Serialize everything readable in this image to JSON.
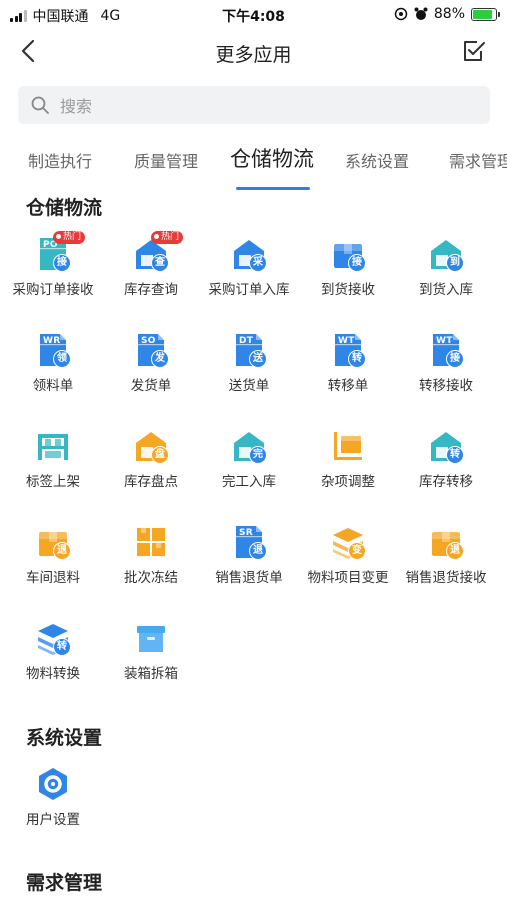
{
  "status_bar": {
    "carrier": "中国联通",
    "network": "4G",
    "time": "下午4:08",
    "battery": "88%"
  },
  "nav": {
    "title": "更多应用"
  },
  "search": {
    "placeholder": "搜索"
  },
  "tabs": [
    {
      "label": "制造执行"
    },
    {
      "label": "质量管理"
    },
    {
      "label": "仓储物流",
      "active": true
    },
    {
      "label": "系统设置"
    },
    {
      "label": "需求管理"
    }
  ],
  "sections": {
    "warehouse": {
      "title": "仓储物流",
      "apps": [
        {
          "label": "采购订单接收",
          "icon": "purchase-order-receive-icon",
          "code": "PO",
          "badge": "接",
          "hot": "热门"
        },
        {
          "label": "库存查询",
          "icon": "inventory-query-icon",
          "badge": "查",
          "hot": "热门"
        },
        {
          "label": "采购订单入库",
          "icon": "purchase-order-inbound-icon",
          "badge": "采"
        },
        {
          "label": "到货接收",
          "icon": "arrival-receive-icon",
          "badge": "接"
        },
        {
          "label": "到货入库",
          "icon": "arrival-inbound-icon",
          "badge": "到"
        },
        {
          "label": "领料单",
          "icon": "material-requisition-icon",
          "code": "WR",
          "badge": "领"
        },
        {
          "label": "发货单",
          "icon": "shipping-order-icon",
          "code": "SO",
          "badge": "发"
        },
        {
          "label": "送货单",
          "icon": "delivery-note-icon",
          "code": "DT",
          "badge": "送"
        },
        {
          "label": "转移单",
          "icon": "transfer-order-icon",
          "code": "WT",
          "badge": "转"
        },
        {
          "label": "转移接收",
          "icon": "transfer-receive-icon",
          "code": "WT",
          "badge": "接"
        },
        {
          "label": "标签上架",
          "icon": "label-shelving-icon"
        },
        {
          "label": "库存盘点",
          "icon": "stocktaking-icon",
          "badge": "盘"
        },
        {
          "label": "完工入库",
          "icon": "completion-inbound-icon",
          "badge": "完"
        },
        {
          "label": "杂项调整",
          "icon": "misc-adjustment-icon"
        },
        {
          "label": "库存转移",
          "icon": "inventory-transfer-icon",
          "badge": "转"
        },
        {
          "label": "车间退料",
          "icon": "workshop-return-icon",
          "badge": "退"
        },
        {
          "label": "批次冻结",
          "icon": "batch-freeze-icon"
        },
        {
          "label": "销售退货单",
          "icon": "sales-return-order-icon",
          "code": "SR",
          "badge": "退"
        },
        {
          "label": "物料项目变更",
          "icon": "material-item-change-icon",
          "badge": "变"
        },
        {
          "label": "销售退货接收",
          "icon": "sales-return-receive-icon",
          "badge": "退"
        },
        {
          "label": "物料转换",
          "icon": "material-conversion-icon",
          "badge": "转"
        },
        {
          "label": "装箱拆箱",
          "icon": "packing-unpacking-icon"
        }
      ]
    },
    "system": {
      "title": "系统设置",
      "apps": [
        {
          "label": "用户设置",
          "icon": "user-settings-icon"
        }
      ]
    },
    "demand": {
      "title": "需求管理"
    }
  },
  "colors": {
    "accent": "#2f7ee8",
    "teal": "#35b8c4",
    "blue": "#2f86e6",
    "orange": "#f5a623",
    "hot": "#e93a3a"
  }
}
